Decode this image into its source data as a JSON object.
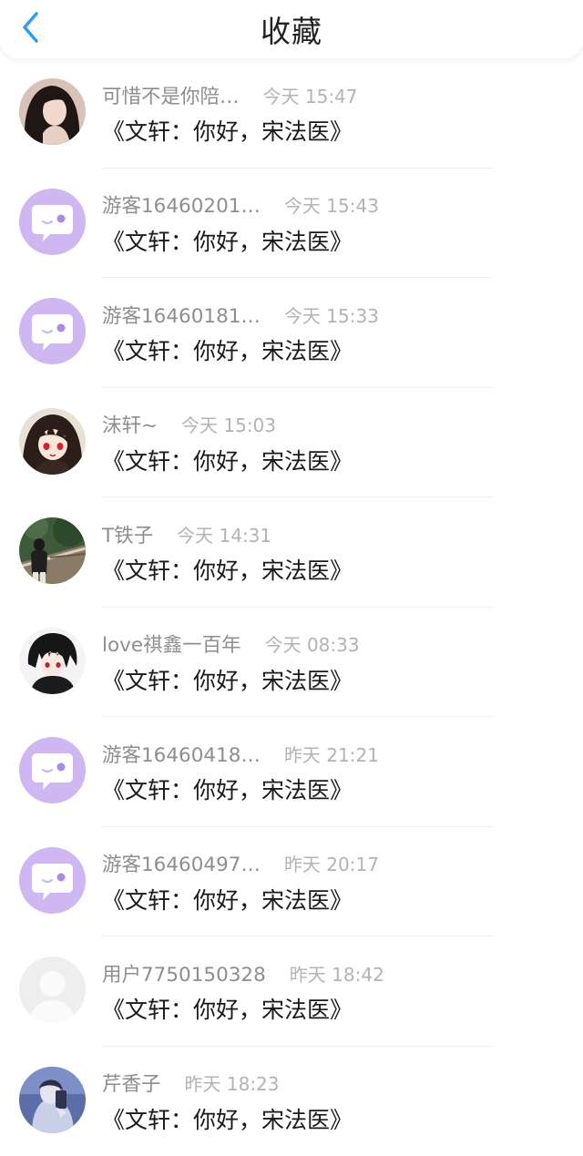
{
  "header": {
    "title": "收藏"
  },
  "items": [
    {
      "name": "可惜不是你陪…",
      "time": "今天 15:47",
      "book": "《文轩：你好，宋法医》",
      "avatar": "photo-girl"
    },
    {
      "name": "游客16460201…",
      "time": "今天 15:43",
      "book": "《文轩：你好，宋法医》",
      "avatar": "default-chat-bubble"
    },
    {
      "name": "游客16460181…",
      "time": "今天 15:33",
      "book": "《文轩：你好，宋法医》",
      "avatar": "default-chat-bubble"
    },
    {
      "name": "沫轩~",
      "time": "今天 15:03",
      "book": "《文轩：你好，宋法医》",
      "avatar": "anime-girl-red-eyes"
    },
    {
      "name": "T铁子",
      "time": "今天 14:31",
      "book": "《文轩：你好，宋法医》",
      "avatar": "photo-bridge"
    },
    {
      "name": "love祺鑫一百年",
      "time": "今天 08:33",
      "book": "《文轩：你好，宋法医》",
      "avatar": "anime-boy-dark"
    },
    {
      "name": "游客16460418…",
      "time": "昨天 21:21",
      "book": "《文轩：你好，宋法医》",
      "avatar": "default-chat-bubble"
    },
    {
      "name": "游客16460497…",
      "time": "昨天 20:17",
      "book": "《文轩：你好，宋法医》",
      "avatar": "default-chat-bubble"
    },
    {
      "name": "用户7750150328",
      "time": "昨天 18:42",
      "book": "《文轩：你好，宋法医》",
      "avatar": "default-person-silhouette"
    },
    {
      "name": "芹香子",
      "time": "昨天 18:23",
      "book": "《文轩：你好，宋法医》",
      "avatar": "photo-blue"
    }
  ],
  "colors": {
    "back_arrow": "#2b9ff2",
    "default_avatar_bg": "#cfb7f2",
    "name_text": "#8e8e8e",
    "time_text": "#b3b3b3",
    "book_text": "#1a1a1a"
  }
}
